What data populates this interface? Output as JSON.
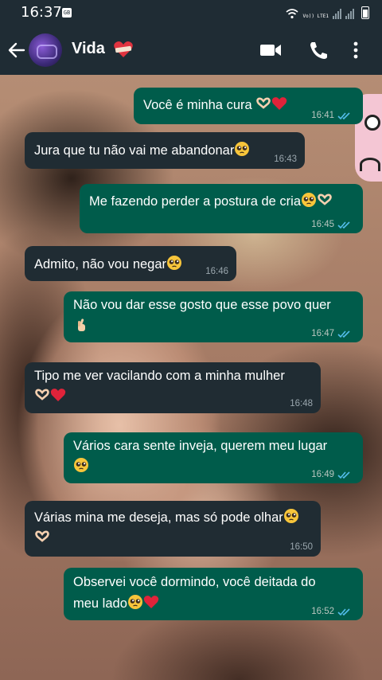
{
  "status_bar": {
    "time": "16:37",
    "lte_label": "Vo)) LTE1"
  },
  "header": {
    "contact_name": "Vida",
    "name_emoji": "heart-bandage-icon"
  },
  "messages": [
    {
      "dir": "out",
      "text": "Você é minha cura",
      "emojis": [
        "heart-hands-icon",
        "red-heart-icon"
      ],
      "time": "16:41",
      "read": true
    },
    {
      "dir": "in",
      "text": "Jura que tu não vai me abandonar",
      "emojis": [
        "pleading-face-icon"
      ],
      "time": "16:43"
    },
    {
      "dir": "out",
      "text": "Me fazendo perder a postura de cria",
      "emojis": [
        "pleading-face-icon",
        "heart-hands-icon"
      ],
      "time": "16:45",
      "read": true
    },
    {
      "dir": "in",
      "text": "Admito, não vou negar",
      "emojis": [
        "pleading-face-icon"
      ],
      "time": "16:46"
    },
    {
      "dir": "out",
      "text": "Não vou dar esse gosto que esse povo quer",
      "emojis": [
        "hand-with-index-finger-and-thumb-crossed-icon"
      ],
      "time": "16:47",
      "read": true
    },
    {
      "dir": "in",
      "text": "Tipo me ver vacilando com a minha mulher",
      "emojis": [
        "heart-hands-icon",
        "red-heart-icon"
      ],
      "time": "16:48"
    },
    {
      "dir": "out",
      "text": "Vários cara sente inveja, querem meu lugar",
      "emojis": [
        "pleading-face-icon"
      ],
      "time": "16:49",
      "read": true
    },
    {
      "dir": "in",
      "text": "Várias mina me deseja, mas só pode olhar",
      "emojis": [
        "pleading-face-icon",
        "heart-hands-icon"
      ],
      "time": "16:50"
    },
    {
      "dir": "out",
      "text": "Observei você dormindo, você deitada do",
      "text2": "meu lado",
      "emojis": [
        "pleading-face-icon",
        "red-heart-icon"
      ],
      "time": "16:52",
      "read": true
    }
  ],
  "colors": {
    "header": "#1f2c34",
    "outgoing": "#005c4b",
    "incoming": "#202c33",
    "read_ticks": "#53bdeb"
  }
}
